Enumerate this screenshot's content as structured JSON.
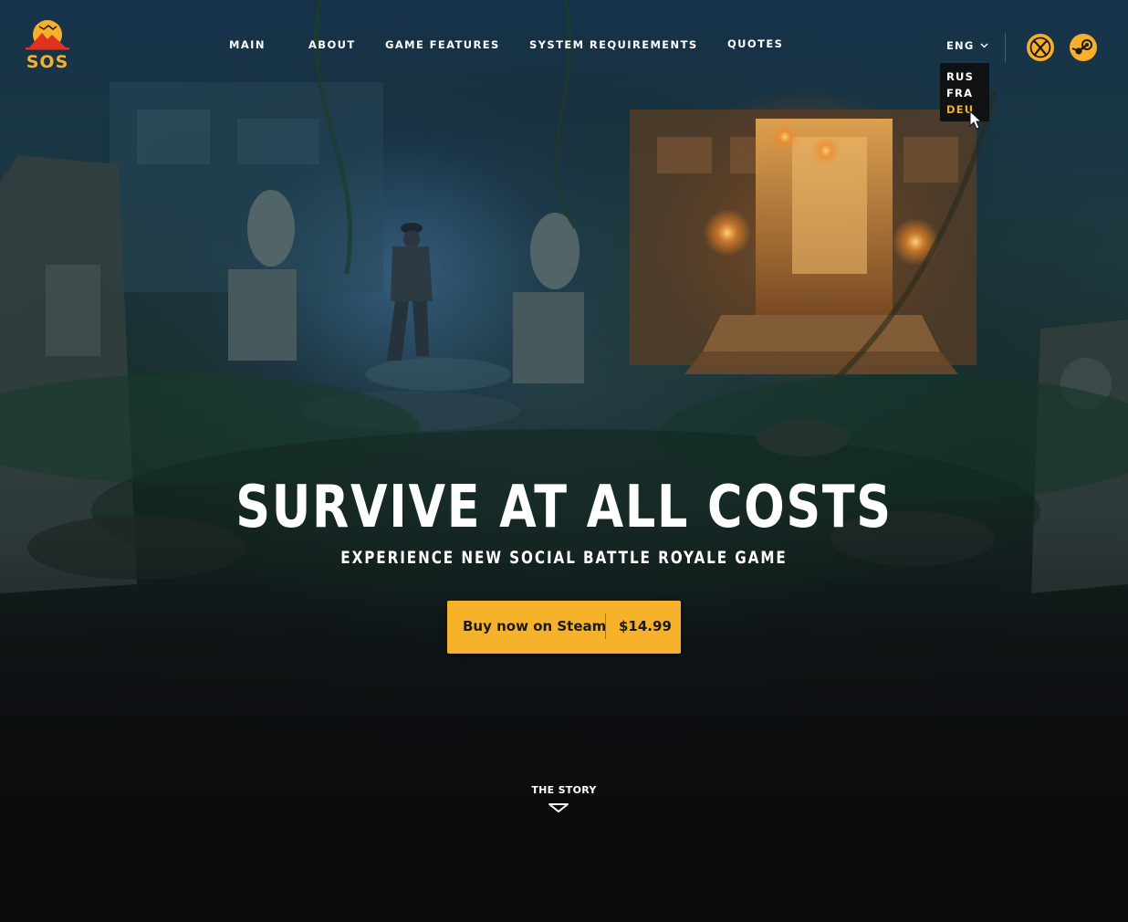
{
  "brand": {
    "logo_text": "SOS",
    "accent": "#f7b02b",
    "logo_red": "#e0321f"
  },
  "nav": {
    "items": [
      {
        "label": "MAIN"
      },
      {
        "label": "ABOUT"
      },
      {
        "label": "GAME FEATURES"
      },
      {
        "label": "SYSTEM REQUIREMENTS"
      },
      {
        "label": "QUOTES"
      }
    ]
  },
  "language": {
    "current": "ENG",
    "options": [
      {
        "label": "RUS",
        "active": false
      },
      {
        "label": "FRA",
        "active": false
      },
      {
        "label": "DEU",
        "active": true
      }
    ],
    "active_color": "#f4b028"
  },
  "platforms": [
    {
      "icon": "xbox-icon"
    },
    {
      "icon": "steam-icon"
    }
  ],
  "hero": {
    "headline": "SURVIVE AT ALL COSTS",
    "subheadline": "EXPERIENCE NEW SOCIAL BATTLE ROYALE GAME",
    "cta": {
      "label": "Buy now on Steam",
      "price": "$14.99",
      "color": "#f7b22c"
    },
    "scroll_hint": "THE STORY"
  }
}
